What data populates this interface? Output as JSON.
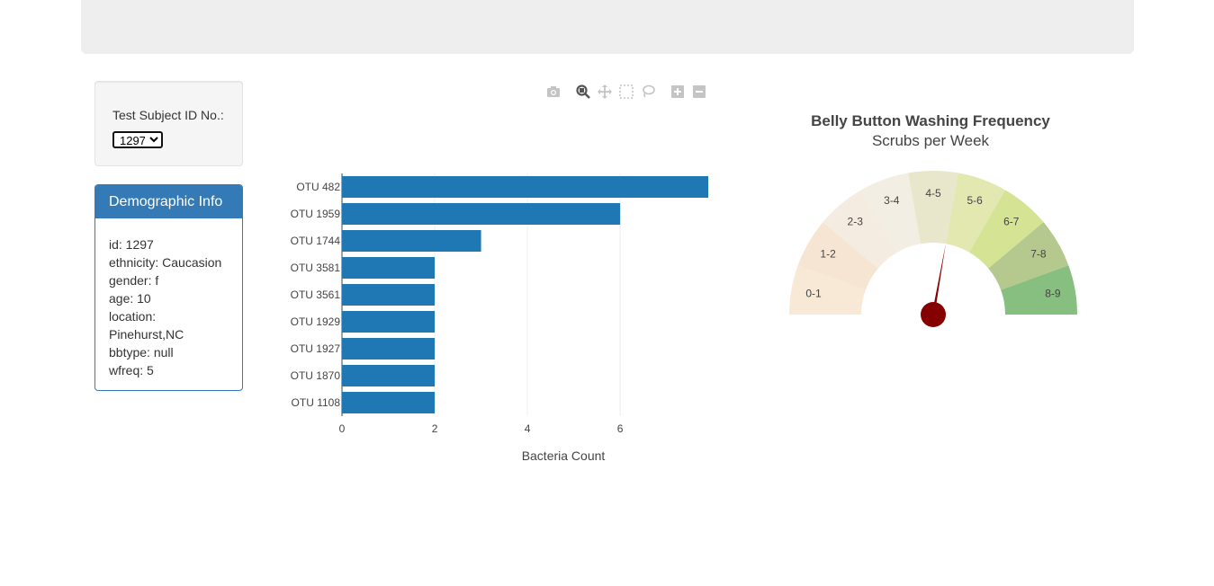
{
  "selector": {
    "label": "Test Subject ID No.:",
    "selected": "1297"
  },
  "demographics": {
    "title": "Demographic Info",
    "lines": [
      "id: 1297",
      "ethnicity: Caucasion",
      "gender: f",
      "age: 10",
      "location:",
      "Pinehurst,NC",
      "bbtype: null",
      "wfreq: 5"
    ]
  },
  "modebar": {
    "icons": [
      "camera-icon",
      "zoom-icon",
      "pan-icon",
      "box-select-icon",
      "lasso-select-icon",
      "zoom-in-icon",
      "zoom-out-icon"
    ]
  },
  "colors": {
    "bar": "#1f77b4",
    "panel": "#337ab7",
    "needle": "#850000"
  },
  "chart_data": [
    {
      "type": "bar",
      "orientation": "horizontal",
      "categories": [
        "OTU 482",
        "OTU 1959",
        "OTU 1744",
        "OTU 3581",
        "OTU 3561",
        "OTU 1929",
        "OTU 1927",
        "OTU 1870",
        "OTU 1108"
      ],
      "values": [
        8,
        6,
        3,
        2,
        2,
        2,
        2,
        2,
        2
      ],
      "xlabel": "Bacteria Count",
      "xlim": [
        0,
        7.9
      ],
      "xticks": [
        0,
        2,
        4,
        6
      ],
      "grid": true
    },
    {
      "type": "gauge",
      "title": "Belly Button Washing Frequency",
      "subtitle": "Scrubs per Week",
      "range": [
        0,
        9
      ],
      "value": 5,
      "segments": [
        {
          "label": "0-1",
          "color": "#f8e9d7"
        },
        {
          "label": "1-2",
          "color": "#f6e5d3"
        },
        {
          "label": "2-3",
          "color": "#f4ece0"
        },
        {
          "label": "3-4",
          "color": "#f3eee3"
        },
        {
          "label": "4-5",
          "color": "#e8e6cb"
        },
        {
          "label": "5-6",
          "color": "#e3e8b1"
        },
        {
          "label": "6-7",
          "color": "#d4e494"
        },
        {
          "label": "7-8",
          "color": "#b5c98e"
        },
        {
          "label": "8-9",
          "color": "#86bf7f"
        }
      ]
    }
  ]
}
